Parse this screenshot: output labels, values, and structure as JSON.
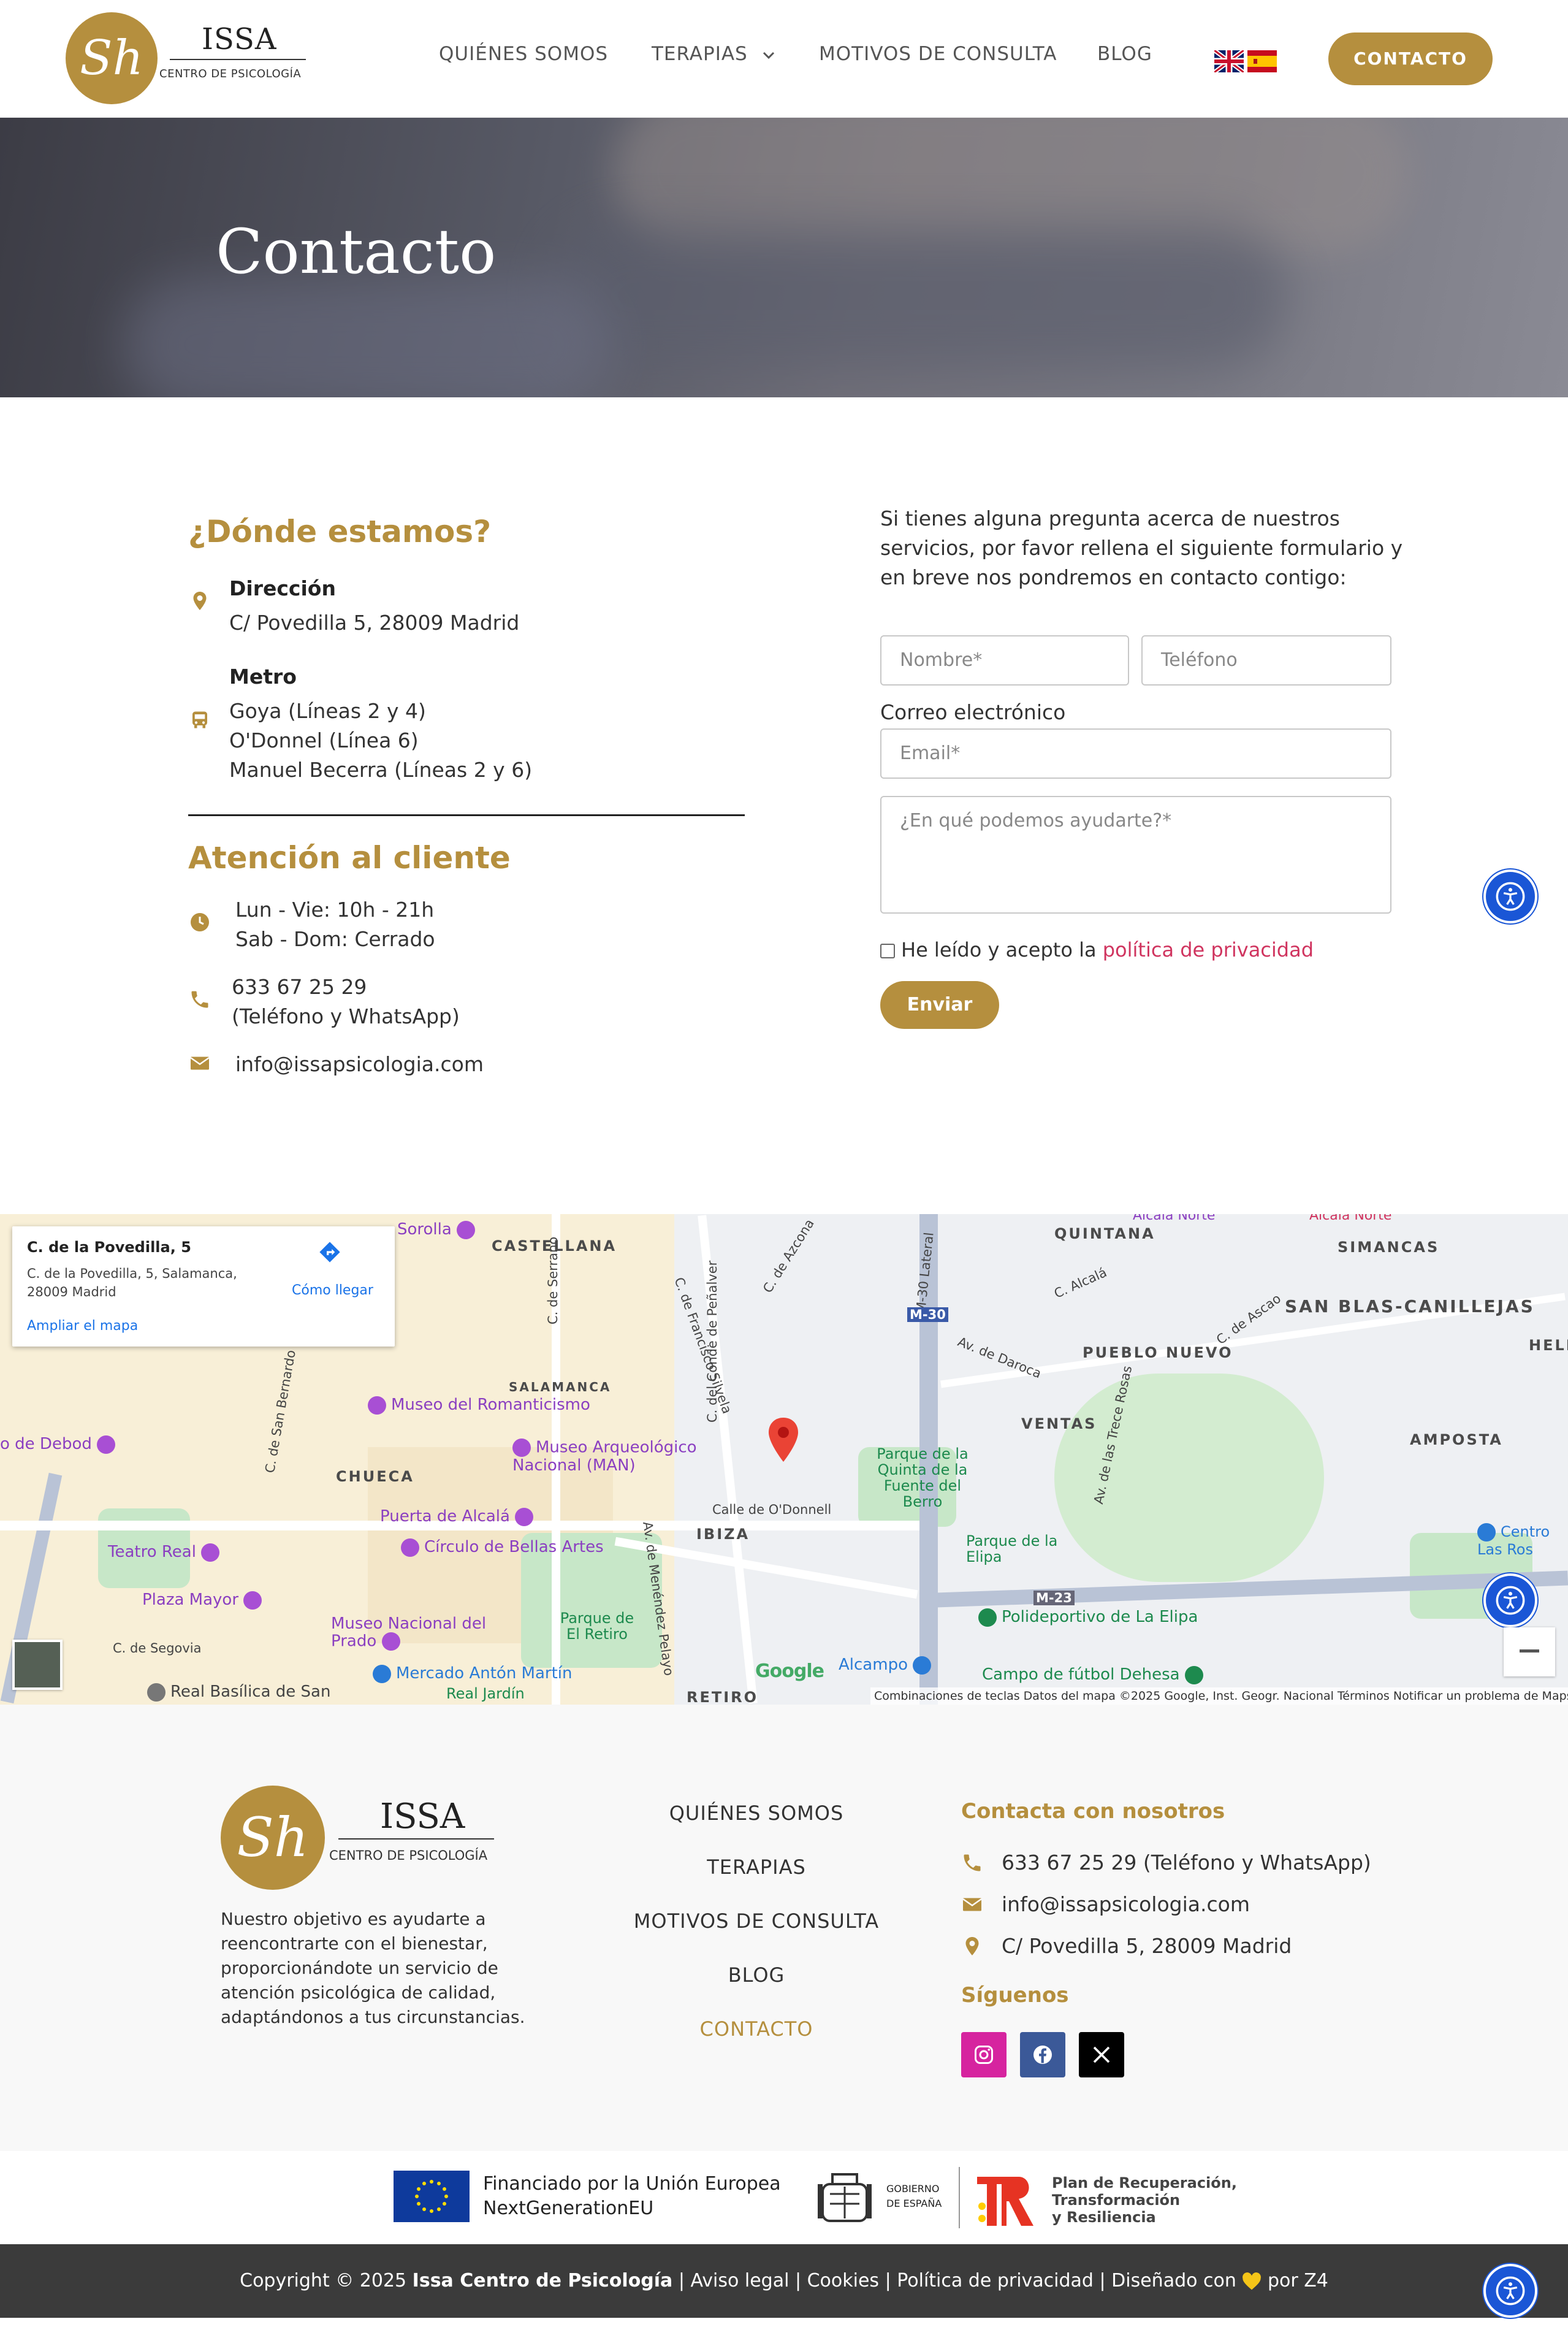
{
  "header": {
    "logo": {
      "monogram": "Sh",
      "name": "ISSA",
      "subtitle": "CENTRO DE PSICOLOGÍA"
    },
    "nav": [
      "QUIÉNES SOMOS",
      "TERAPIAS",
      "MOTIVOS DE CONSULTA",
      "BLOG"
    ],
    "cta_label": "CONTACTO",
    "flag_icons": [
      "uk-flag-icon",
      "spain-flag-icon"
    ]
  },
  "hero": {
    "title": "Contacto"
  },
  "location": {
    "heading": "¿Dónde estamos?",
    "address_label": "Dirección",
    "address": "C/ Povedilla 5, 28009 Madrid",
    "metro_label": "Metro",
    "metro": [
      "Goya (Líneas 2 y 4)",
      "O'Donnel (Línea 6)",
      "Manuel Becerra (Líneas 2 y 6)"
    ]
  },
  "service": {
    "heading": "Atención al cliente",
    "hours": [
      "Lun - Vie: 10h - 21h",
      "Sab - Dom: Cerrado"
    ],
    "phone": [
      "633 67 25 29",
      "(Teléfono y WhatsApp)"
    ],
    "email": "info@issapsicologia.com"
  },
  "form": {
    "intro": "Si tienes alguna pregunta acerca de nuestros servicios, por favor rellena el siguiente formulario y en breve nos pondremos en contacto contigo:",
    "name_placeholder": "Nombre*",
    "phone_placeholder": "Teléfono",
    "email_label": "Correo electrónico",
    "email_placeholder": "Email*",
    "message_placeholder": "¿En qué podemos ayudarte?*",
    "agree_text": "He leído y acepto la ",
    "agree_link": "política de privacidad",
    "submit_label": "Enviar"
  },
  "map": {
    "infobox": {
      "title": "C. de la Povedilla, 5",
      "address": "C. de la Povedilla, 5, Salamanca, 28009 Madrid",
      "directions": "Cómo llegar",
      "enlarge": "Ampliar el mapa"
    },
    "districts": [
      "CASTELLANA",
      "QUINTANA",
      "SIMANCAS",
      "SAN BLAS-CANILLEJAS",
      "SALAMANCA",
      "PUEBLO NUEVO",
      "VENTAS",
      "AMPOSTA",
      "CHUECA",
      "IBIZA",
      "RETIRO",
      "HELL"
    ],
    "pois": [
      "Sorolla",
      "Museo del Romanticismo",
      "Museo Arqueológico Nacional (MAN)",
      "Puerta de Alcalá",
      "Círculo de Bellas Artes",
      "Teatro Real",
      "Plaza Mayor",
      "Museo Nacional del Prado",
      "Mercado Antón Martín",
      "Real Basílica de San",
      "o de Debod",
      "Parque de la Quinta de la Fuente del Berro",
      "Parque de la Elipa",
      "Polideportivo de La Elipa",
      "Parque de El Retiro",
      "Alcampo",
      "Campo de fútbol Dehesa",
      "Centro Las Ros",
      "Real Jardín",
      "Alcalá Norte",
      "Alcalá Norte"
    ],
    "streets": [
      "C. de Francisco Silvela",
      "C. de Azcona",
      "M-30 Lateral",
      "C. del Conde de Peñalver",
      "C. de Serrano",
      "C. de San Bernardo",
      "Calle de O'Donnell",
      "Av. de Menéndez Pelayo",
      "Av. de Daroca",
      "Av. de las Trece Rosas",
      "C. de Segovia",
      "C. Alcalá",
      "C. de Ascao",
      "M-23",
      "M-30"
    ],
    "attribution": "Combinaciones de teclas    Datos del mapa ©2025 Google, Inst. Geogr. Nacional    Términos    Notificar un problema de Maps",
    "google": "Google"
  },
  "footer": {
    "logo": {
      "monogram": "Sh",
      "name": "ISSA",
      "subtitle": "CENTRO DE PSICOLOGÍA"
    },
    "description": "Nuestro objetivo es ayudarte a reencontrarte con el bienestar, proporcionándote un servicio de atención psicológica de calidad, adaptándonos a tus circunstancias.",
    "nav": [
      "QUIÉNES SOMOS",
      "TERAPIAS",
      "MOTIVOS DE CONSULTA",
      "BLOG",
      "CONTACTO"
    ],
    "contact_heading": "Contacta con nosotros",
    "phone": "633 67 25 29 (Teléfono y WhatsApp)",
    "email": "info@issapsicologia.com",
    "address": "C/ Povedilla 5, 28009 Madrid",
    "follow_heading": "Síguenos"
  },
  "funding": {
    "eu_line1": "Financiado por la Unión Europea",
    "eu_line2": "NextGenerationEU",
    "gov_line1": "GOBIERNO",
    "gov_line2": "DE ESPAÑA",
    "plan_line1": "Plan de Recuperación,",
    "plan_line2": "Transformación",
    "plan_line3": "y Resiliencia"
  },
  "copyright": {
    "prefix": "Copyright © 2025 ",
    "brand": "Issa Centro de Psicología",
    "links": " | Aviso legal | Cookies | Política de privacidad | Diseñado con ",
    "suffix": " por Z4"
  },
  "colors": {
    "gold": "#B58F3E",
    "dark": "#3b3b3b",
    "link": "#d0345f",
    "accessibility": "#1a56d6",
    "instagram": "#d6249f",
    "facebook": "#3b5998"
  }
}
